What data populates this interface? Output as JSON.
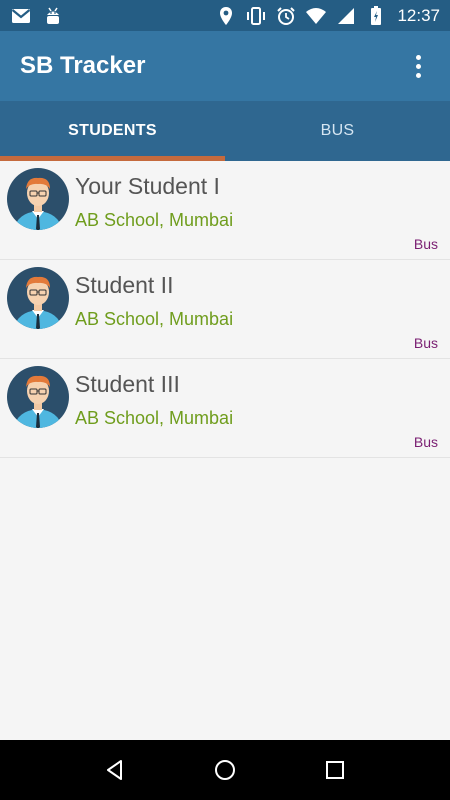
{
  "status_bar": {
    "time": "12:37",
    "left_icons": [
      "gmail-icon",
      "android-debug-icon"
    ],
    "right_icons": [
      "location-icon",
      "vibrate-icon",
      "alarm-icon",
      "wifi-icon",
      "signal-icon",
      "battery-icon"
    ]
  },
  "app_bar": {
    "title": "SB Tracker",
    "overflow_icon": "more-vert-icon"
  },
  "tabs": [
    {
      "label": "STUDENTS",
      "selected": true
    },
    {
      "label": "BUS",
      "selected": false
    }
  ],
  "students": [
    {
      "name": "Your Student I",
      "school": "AB School, Mumbai",
      "action": "Bus"
    },
    {
      "name": "Student II",
      "school": "AB School, Mumbai",
      "action": "Bus"
    },
    {
      "name": "Student III",
      "school": "AB School, Mumbai",
      "action": "Bus"
    }
  ],
  "colors": {
    "status_bar": "#255d84",
    "app_bar": "#3576a3",
    "tabs": "#2f6790",
    "tab_indicator": "#c56a3d",
    "school_text": "#6f9d1d",
    "bus_text": "#7a1f72"
  },
  "nav_bar": {
    "icons": [
      "back-icon",
      "home-icon",
      "recents-icon"
    ]
  }
}
